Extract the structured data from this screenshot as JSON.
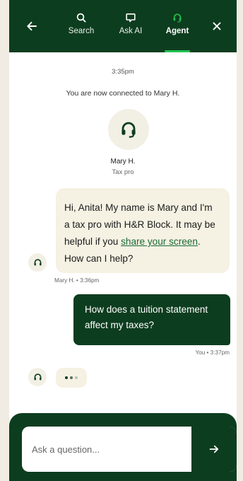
{
  "colors": {
    "brand_dark": "#0d3d1f",
    "accent_green": "#23c552",
    "bubble_light": "#f5f1e3",
    "link": "#1a6a34"
  },
  "header": {
    "back_icon": "arrow-left-icon",
    "close_icon": "close-icon",
    "tabs": [
      {
        "label": "Search",
        "icon": "search-icon",
        "active": false
      },
      {
        "label": "Ask AI",
        "icon": "chat-icon",
        "active": false
      },
      {
        "label": "Agent",
        "icon": "headset-icon",
        "active": true
      }
    ]
  },
  "chat": {
    "timestamp": "3:35pm",
    "connected_text": "You are now connected to Mary H.",
    "agent": {
      "name": "Mary H.",
      "role": "Tax pro"
    },
    "agent_message": {
      "text_before": "Hi, Anita! My name is Mary and I'm a tax pro with H&R Block. It may be helpful if you ",
      "link_text": "share your screen",
      "text_after": ". How can I help?",
      "meta": "Mary H. • 3:36pm"
    },
    "user_message": {
      "text": "How does a tuition statement affect my taxes?",
      "meta": "You • 3:37pm"
    }
  },
  "composer": {
    "placeholder": "Ask a question...",
    "value": "",
    "send_icon": "arrow-right-icon"
  }
}
